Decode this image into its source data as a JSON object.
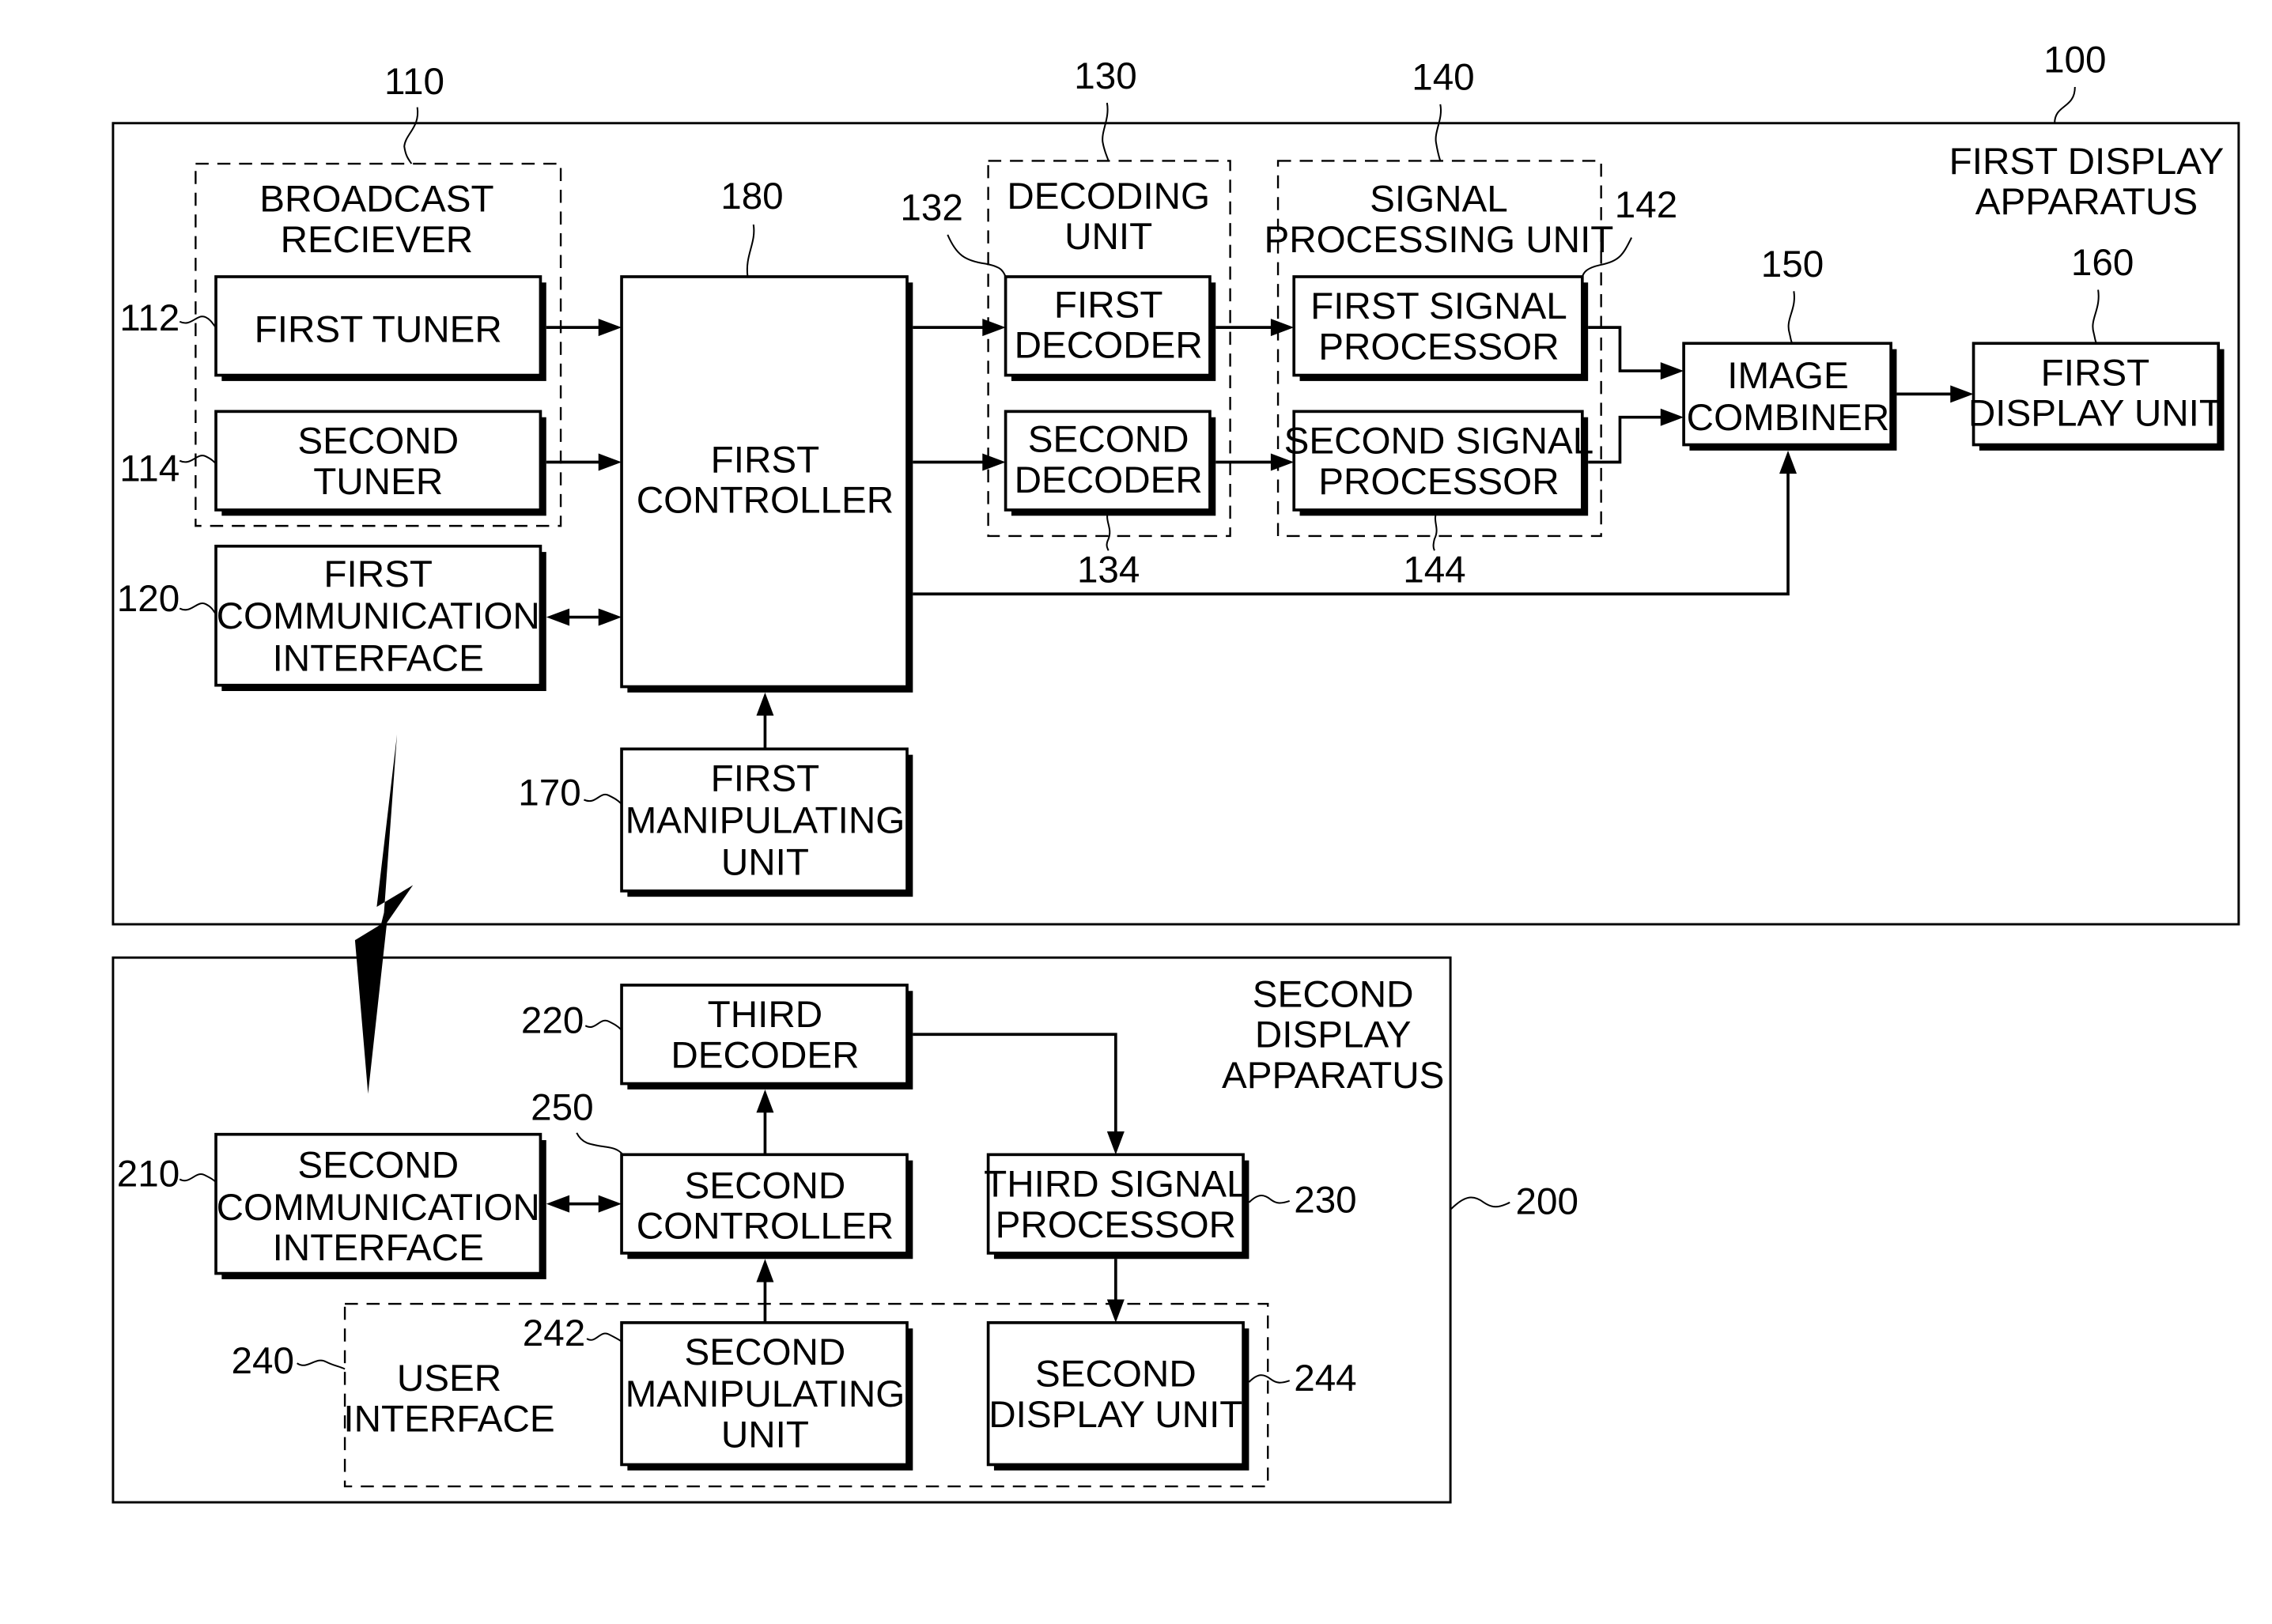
{
  "figure": {
    "apparatus1": {
      "ref": "100",
      "title": [
        "FIRST DISPLAY",
        "APPARATUS"
      ]
    },
    "apparatus2": {
      "ref": "200",
      "title": [
        "SECOND",
        "DISPLAY",
        "APPARATUS"
      ]
    },
    "groups": {
      "broadcast_receiver": {
        "ref": "110",
        "label": [
          "BROADCAST",
          "RECIEVER"
        ]
      },
      "decoding_unit": {
        "ref": "130",
        "label": [
          "DECODING",
          "UNIT"
        ]
      },
      "signal_processing_unit": {
        "ref": "140",
        "label": [
          "SIGNAL",
          "PROCESSING UNIT"
        ]
      },
      "user_interface": {
        "ref": "240",
        "label": [
          "USER",
          "INTERFACE"
        ]
      }
    },
    "blocks": {
      "first_tuner": {
        "ref": "112",
        "label": [
          "FIRST TUNER"
        ]
      },
      "second_tuner": {
        "ref": "114",
        "label": [
          "SECOND",
          "TUNER"
        ]
      },
      "first_comm": {
        "ref": "120",
        "label": [
          "FIRST",
          "COMMUNICATION",
          "INTERFACE"
        ]
      },
      "first_controller": {
        "ref": "180",
        "label": [
          "FIRST",
          "CONTROLLER"
        ]
      },
      "first_manip": {
        "ref": "170",
        "label": [
          "FIRST",
          "MANIPULATING",
          "UNIT"
        ]
      },
      "first_decoder": {
        "ref": "132",
        "label": [
          "FIRST",
          "DECODER"
        ]
      },
      "second_decoder": {
        "ref": "134",
        "label": [
          "SECOND",
          "DECODER"
        ]
      },
      "first_sp": {
        "ref": "142",
        "label": [
          "FIRST SIGNAL",
          "PROCESSOR"
        ]
      },
      "second_sp": {
        "ref": "144",
        "label": [
          "SECOND SIGNAL",
          "PROCESSOR"
        ]
      },
      "image_combiner": {
        "ref": "150",
        "label": [
          "IMAGE",
          "COMBINER"
        ]
      },
      "first_display": {
        "ref": "160",
        "label": [
          "FIRST",
          "DISPLAY UNIT"
        ]
      },
      "second_comm": {
        "ref": "210",
        "label": [
          "SECOND",
          "COMMUNICATION",
          "INTERFACE"
        ]
      },
      "third_decoder": {
        "ref": "220",
        "label": [
          "THIRD",
          "DECODER"
        ]
      },
      "second_controller": {
        "ref": "250",
        "label": [
          "SECOND",
          "CONTROLLER"
        ]
      },
      "third_sp": {
        "ref": "230",
        "label": [
          "THIRD SIGNAL",
          "PROCESSOR"
        ]
      },
      "second_manip": {
        "ref": "242",
        "label": [
          "SECOND",
          "MANIPULATING",
          "UNIT"
        ]
      },
      "second_display": {
        "ref": "244",
        "label": [
          "SECOND",
          "DISPLAY UNIT"
        ]
      }
    },
    "icons": {
      "wireless_link": "lightning-bolt-icon"
    }
  }
}
